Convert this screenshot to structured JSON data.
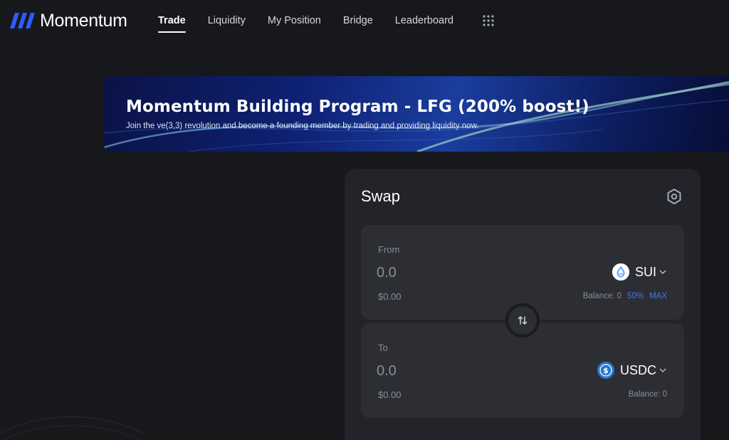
{
  "brand": {
    "name": "Momentum"
  },
  "nav": {
    "items": [
      {
        "label": "Trade",
        "active": true
      },
      {
        "label": "Liquidity",
        "active": false
      },
      {
        "label": "My Position",
        "active": false
      },
      {
        "label": "Bridge",
        "active": false
      },
      {
        "label": "Leaderboard",
        "active": false
      }
    ],
    "more_icon": "grid-dots-icon"
  },
  "banner": {
    "title": "Momentum Building Program - LFG (200% boost!)",
    "subtitle": "Join the ve(3,3) revolution and become a founding member by trading and providing liquidity now."
  },
  "swap": {
    "title": "Swap",
    "settings_icon": "settings-hexagon-icon",
    "from": {
      "label": "From",
      "amount_placeholder": "0.0",
      "usd_value": "$0.00",
      "token": "SUI",
      "balance": "Balance: 0",
      "half_label": "50%",
      "max_label": "MAX"
    },
    "to": {
      "label": "To",
      "amount_placeholder": "0.0",
      "usd_value": "$0.00",
      "token": "USDC",
      "balance": "Balance: 0"
    },
    "switch_icon": "swap-arrows-icon"
  },
  "colors": {
    "background": "#17181c",
    "card": "#232429",
    "input_box": "#2d2e34",
    "accent": "#3d7bf5",
    "logo_blue": "#2f5bff",
    "muted_text": "#8b8d96"
  }
}
